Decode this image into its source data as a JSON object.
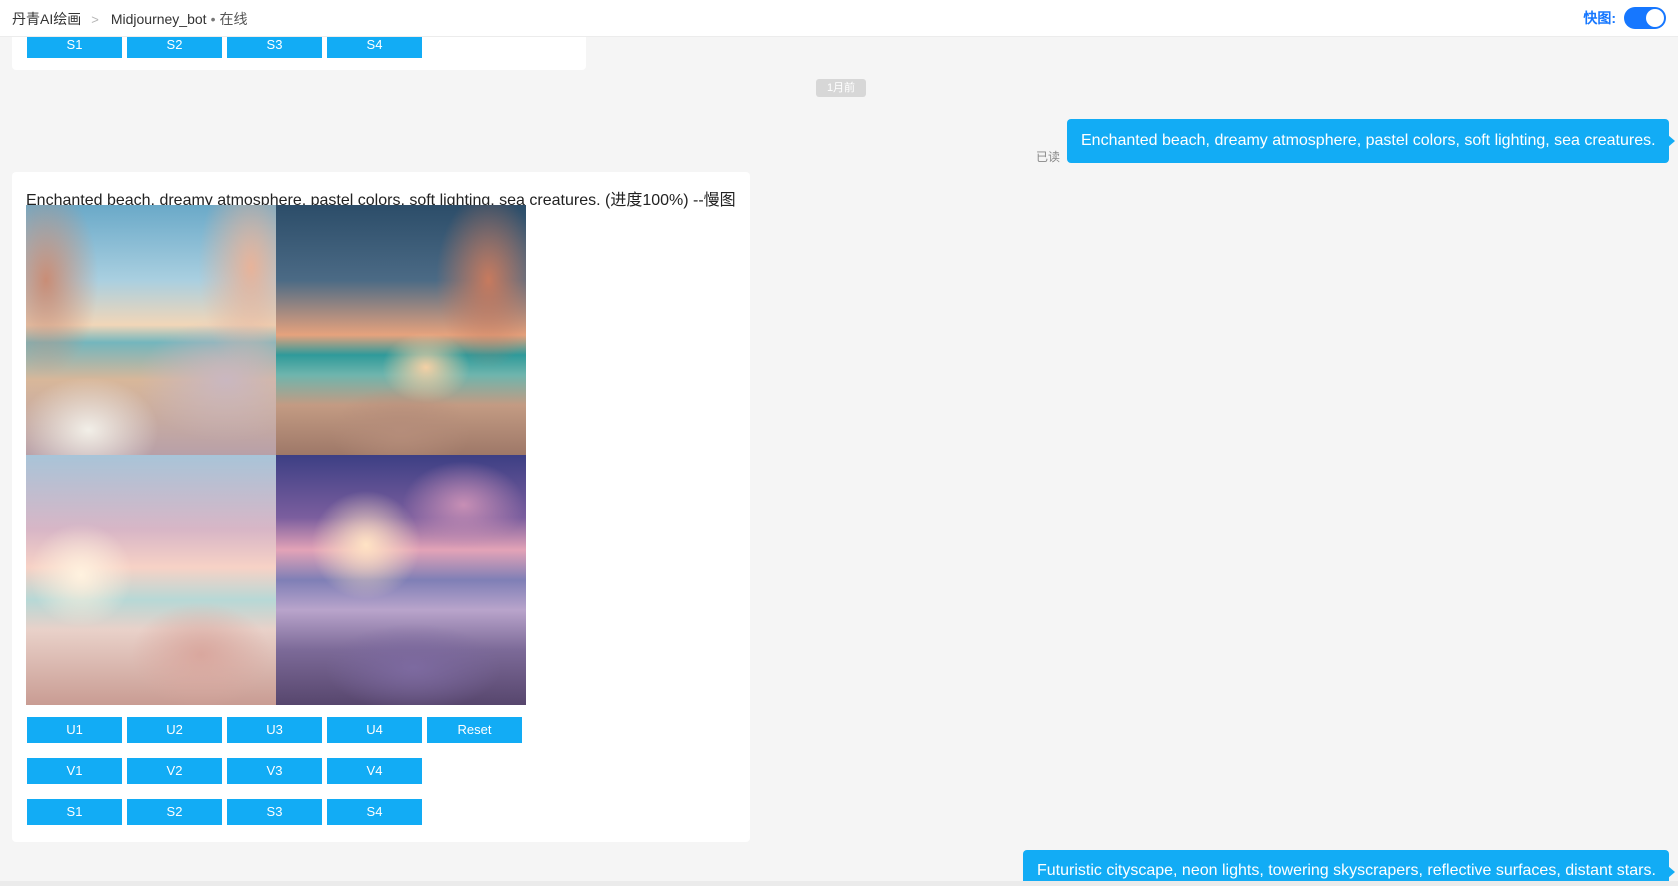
{
  "breadcrumb": {
    "app": "丹青AI绘画",
    "separator": ">",
    "bot_name": "Midjourney_bot",
    "dot": "•",
    "status": "在线"
  },
  "quick_toggle": {
    "label": "快图:",
    "enabled": true
  },
  "colors": {
    "accent": "#12acf5",
    "toggle": "#1677ff"
  },
  "prev_card": {
    "buttons": [
      "S1",
      "S2",
      "S3",
      "S4"
    ]
  },
  "time_badge": "1月前",
  "user_message_1": {
    "text": "Enchanted beach, dreamy atmosphere, pastel colors, soft lighting, sea creatures.",
    "read_label": "已读"
  },
  "bot_message": {
    "text": "Enchanted beach, dreamy atmosphere, pastel colors, soft lighting, sea creatures. (进度100%) --慢图",
    "upscale_buttons": [
      "U1",
      "U2",
      "U3",
      "U4",
      "Reset"
    ],
    "variation_buttons": [
      "V1",
      "V2",
      "V3",
      "V4"
    ],
    "s_buttons": [
      "S1",
      "S2",
      "S3",
      "S4"
    ]
  },
  "user_message_2": {
    "text": "Futuristic cityscape, neon lights, towering skyscrapers, reflective surfaces, distant stars."
  }
}
